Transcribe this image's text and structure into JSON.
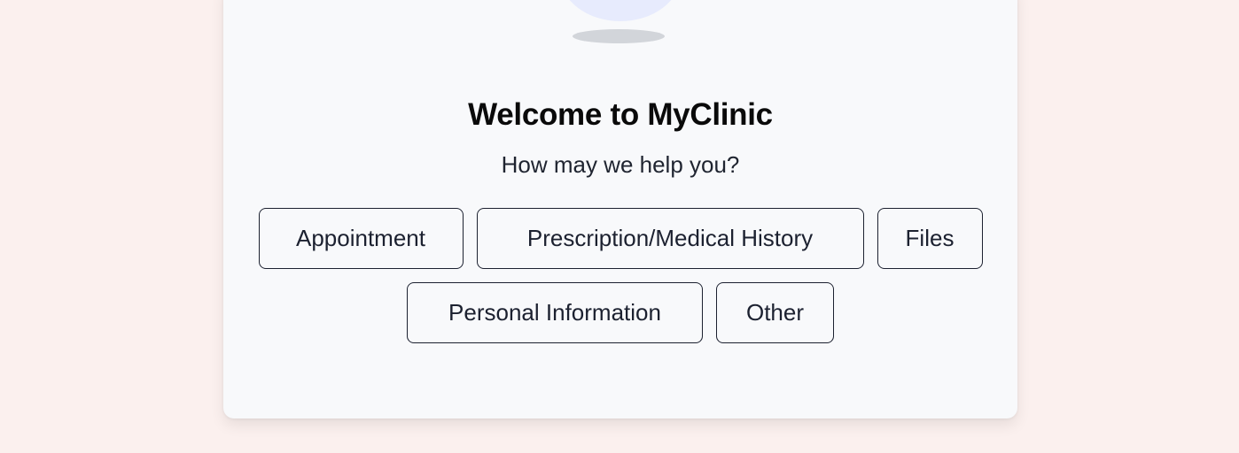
{
  "welcome": {
    "title": "Welcome to MyClinic",
    "subtitle": "How may we help you?"
  },
  "options": [
    {
      "label": "Appointment"
    },
    {
      "label": "Prescription/Medical History"
    },
    {
      "label": "Files"
    },
    {
      "label": "Personal Information"
    },
    {
      "label": "Other"
    }
  ],
  "colors": {
    "page_background": "#fbf0ee",
    "card_background": "#f8f9fb",
    "avatar_fill": "#e7ebfd",
    "button_border": "#1c2130"
  }
}
